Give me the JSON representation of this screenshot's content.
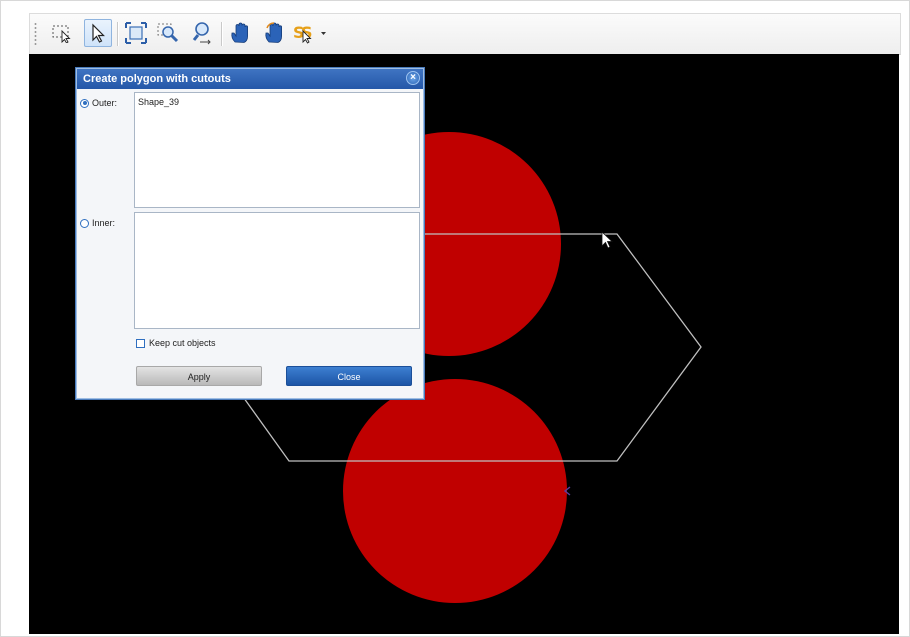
{
  "toolbar": {
    "tools": [
      {
        "icon": "lasso-select-icon",
        "active": false
      },
      {
        "icon": "select-arrow-icon",
        "active": true
      },
      {
        "icon": "zoom-extents-icon",
        "active": false
      },
      {
        "icon": "zoom-window-icon",
        "active": false
      },
      {
        "icon": "zoom-inout-icon",
        "active": false
      },
      {
        "icon": "pan-hand-icon",
        "active": false
      },
      {
        "icon": "rotate-hand-icon",
        "active": false
      },
      {
        "icon": "snap-dropdown-icon",
        "active": false
      }
    ]
  },
  "dialog": {
    "title": "Create polygon with cutouts",
    "close_glyph": "×",
    "outer_label": "Outer:",
    "outer_items": [
      "Shape_39"
    ],
    "inner_label": "Inner:",
    "inner_items": [],
    "keep_cut_label": "Keep cut objects",
    "keep_cut_checked": false,
    "apply_label": "Apply",
    "close_label": "Close"
  },
  "canvas": {
    "background": "#000000",
    "shape_fill": "#c00000",
    "outline_color": "#bfbfbf"
  }
}
